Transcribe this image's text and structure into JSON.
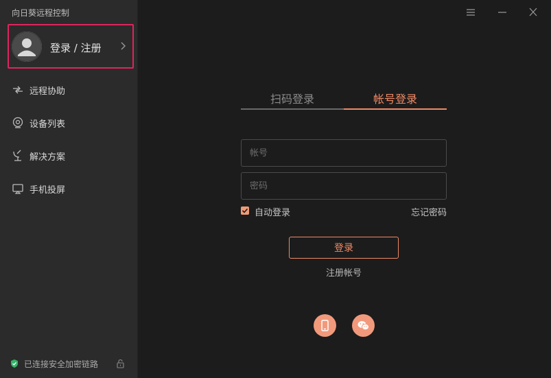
{
  "app": {
    "title": "向日葵远程控制"
  },
  "login_card": {
    "label": "登录 / 注册"
  },
  "sidebar": {
    "items": [
      {
        "label": "远程协助",
        "icon": "remote-assist-icon"
      },
      {
        "label": "设备列表",
        "icon": "device-list-icon"
      },
      {
        "label": "解决方案",
        "icon": "solution-icon"
      },
      {
        "label": "手机投屏",
        "icon": "screen-cast-icon"
      }
    ]
  },
  "status": {
    "text": "已连接安全加密链路"
  },
  "tabs": [
    {
      "label": "扫码登录",
      "active": false
    },
    {
      "label": "帐号登录",
      "active": true
    }
  ],
  "form": {
    "account_placeholder": "帐号",
    "password_placeholder": "密码",
    "auto_login_label": "自动登录",
    "auto_login_checked": true,
    "forgot_label": "忘记密码",
    "login_button": "登录",
    "register_label": "注册帐号"
  },
  "colors": {
    "accent": "#f08a66",
    "sidebar_bg": "#2b2b2b",
    "main_bg": "#1c1c1c",
    "highlight_border": "#e0245e"
  }
}
